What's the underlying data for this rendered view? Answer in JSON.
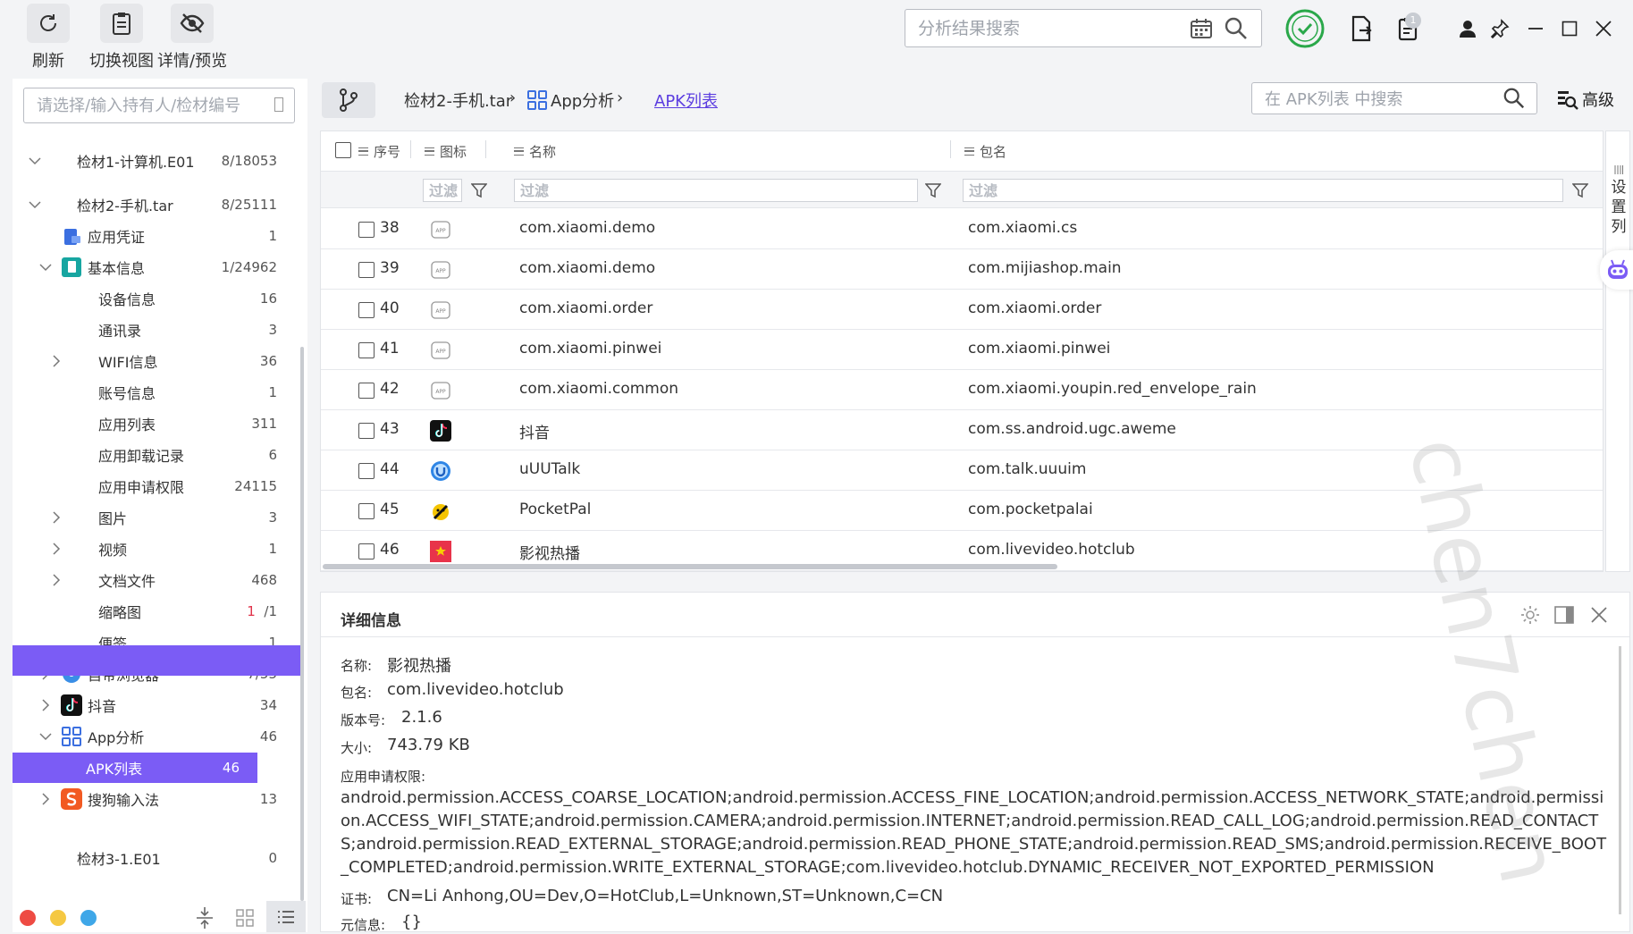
{
  "toolbar": {
    "refresh": "刷新",
    "switch_view": "切换视图",
    "details_preview": "详情/预览",
    "search_placeholder": "分析结果搜索",
    "notification_count": "1"
  },
  "left_panel": {
    "search_placeholder": "请选择/输入持有人/检材编号",
    "tree": [
      {
        "label": "检材1-计算机.E01",
        "count": "8/18053"
      },
      {
        "label": "检材2-手机.tar",
        "count": "8/25111"
      },
      {
        "label": "应用凭证",
        "count": "1"
      },
      {
        "label": "基本信息",
        "count": "1/24962"
      },
      {
        "label": "设备信息",
        "count": "16"
      },
      {
        "label": "通讯录",
        "count": "3"
      },
      {
        "label": "WIFI信息",
        "count": "36"
      },
      {
        "label": "账号信息",
        "count": "1"
      },
      {
        "label": "应用列表",
        "count": "311"
      },
      {
        "label": "应用卸载记录",
        "count": "6"
      },
      {
        "label": "应用申请权限",
        "count": "24115"
      },
      {
        "label": "图片",
        "count": "3"
      },
      {
        "label": "视频",
        "count": "1"
      },
      {
        "label": "文档文件",
        "count": "468"
      },
      {
        "label": "缩略图",
        "count_red": "1",
        "count": "/1"
      },
      {
        "label": "便签",
        "count": "1"
      },
      {
        "label": "自带浏览器",
        "count": "7/55"
      },
      {
        "label": "抖音",
        "count": "34"
      },
      {
        "label": "App分析",
        "count": "46"
      },
      {
        "label": "APK列表",
        "count": "46"
      },
      {
        "label": "搜狗输入法",
        "count": "13"
      },
      {
        "label": "检材3-1.E01",
        "count": "0"
      }
    ]
  },
  "breadcrumb": {
    "items": [
      "检材2-手机.tar",
      "App分析",
      "APK列表"
    ],
    "separator": "›"
  },
  "apk_search": {
    "placeholder": "在 APK列表 中搜索",
    "advanced": "高级"
  },
  "table": {
    "columns": [
      "序号",
      "图标",
      "名称",
      "包名"
    ],
    "filter_placeholder": "过滤",
    "rows": [
      {
        "num": "38",
        "icon": "app-placeholder-icon",
        "name": "com.xiaomi.demo",
        "package": "com.xiaomi.cs"
      },
      {
        "num": "39",
        "icon": "app-placeholder-icon",
        "name": "com.xiaomi.demo",
        "package": "com.mijiashop.main"
      },
      {
        "num": "40",
        "icon": "app-placeholder-icon",
        "name": "com.xiaomi.order",
        "package": "com.xiaomi.order"
      },
      {
        "num": "41",
        "icon": "app-placeholder-icon",
        "name": "com.xiaomi.pinwei",
        "package": "com.xiaomi.pinwei"
      },
      {
        "num": "42",
        "icon": "app-placeholder-icon",
        "name": "com.xiaomi.common",
        "package": "com.xiaomi.youpin.red_envelope_rain"
      },
      {
        "num": "43",
        "icon": "tiktok-icon",
        "name": "抖音",
        "package": "com.ss.android.ugc.aweme"
      },
      {
        "num": "44",
        "icon": "uutalk-icon",
        "name": "uUUTalk",
        "package": "com.talk.uuuim"
      },
      {
        "num": "45",
        "icon": "pocketpal-icon",
        "name": "PocketPal",
        "package": "com.pocketpalai"
      },
      {
        "num": "46",
        "icon": "star-flag-icon",
        "name": "影视热播",
        "package": "com.livevideo.hotclub"
      }
    ]
  },
  "side_tab": {
    "label": "设置列"
  },
  "detail": {
    "title": "详细信息",
    "name_label": "名称:",
    "name": "影视热播",
    "package_label": "包名:",
    "package": "com.livevideo.hotclub",
    "version_label": "版本号:",
    "version": "2.1.6",
    "size_label": "大小:",
    "size": "743.79 KB",
    "permissions_label": "应用申请权限:",
    "permissions": "android.permission.ACCESS_COARSE_LOCATION;android.permission.ACCESS_FINE_LOCATION;android.permission.ACCESS_NETWORK_STATE;android.permission.ACCESS_WIFI_STATE;android.permission.CAMERA;android.permission.INTERNET;android.permission.READ_CALL_LOG;android.permission.READ_CONTACTS;android.permission.READ_EXTERNAL_STORAGE;android.permission.READ_PHONE_STATE;android.permission.READ_SMS;android.permission.RECEIVE_BOOT_COMPLETED;android.permission.WRITE_EXTERNAL_STORAGE;com.livevideo.hotclub.DYNAMIC_RECEIVER_NOT_EXPORTED_PERMISSION",
    "cert_label": "证书:",
    "cert": "CN=Li Anhong,OU=Dev,O=HotClub,L=Unknown,ST=Unknown,C=CN",
    "meta_label": "元信息:",
    "meta": "{}"
  },
  "watermark": "chen7chen",
  "colors": {
    "accent": "#7b5cf5",
    "link": "#5b3de0",
    "green": "#2aa84a"
  }
}
